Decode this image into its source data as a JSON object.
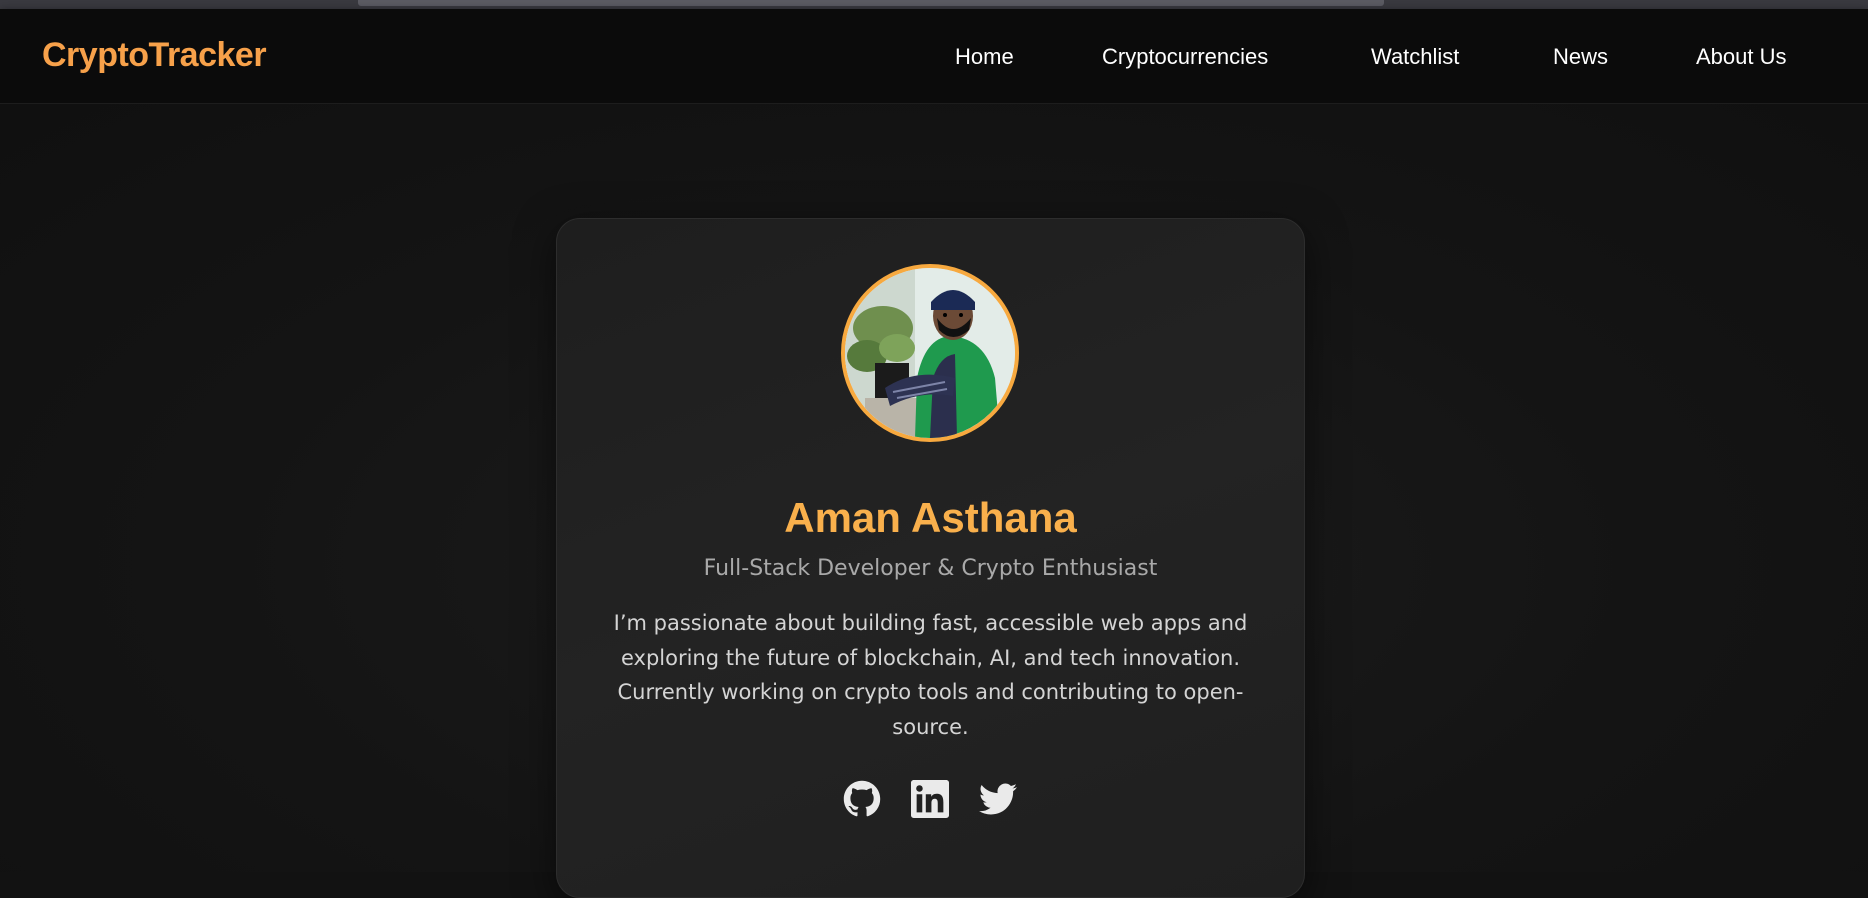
{
  "navbar": {
    "brand": "CryptoTracker",
    "items": [
      {
        "label": "Home"
      },
      {
        "label": "Cryptocurrencies"
      },
      {
        "label": "Watchlist"
      },
      {
        "label": "News"
      },
      {
        "label": "About Us"
      }
    ]
  },
  "profile": {
    "avatar_icon": "profile-photo",
    "name": "Aman Asthana",
    "tagline": "Full-Stack Developer & Crypto Enthusiast",
    "bio": "I’m passionate about building fast, accessible web apps and exploring the future of blockchain, AI, and tech innovation. Currently working on crypto tools and contributing to open-source.",
    "social": [
      {
        "icon": "github-icon"
      },
      {
        "icon": "linkedin-icon"
      },
      {
        "icon": "twitter-icon"
      }
    ]
  },
  "colors": {
    "accent": "#f7a14a",
    "name": "#f9b04c",
    "background": "#121212",
    "card": "#212121"
  }
}
